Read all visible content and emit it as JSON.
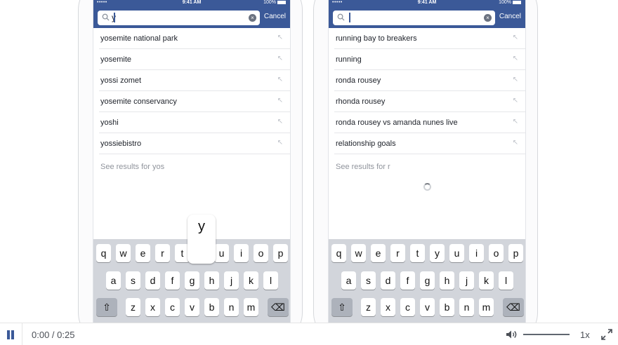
{
  "status": {
    "time": "9:41 AM",
    "battery": "100%",
    "signal": "•••••"
  },
  "left_phone": {
    "typed": "y",
    "cancel_label": "Cancel",
    "suggestions": [
      "yosemite national park",
      "yosemite",
      "yossi zomet",
      "yosemite conservancy",
      "yoshi",
      "yossiebistro"
    ],
    "see_results": "See results for yos",
    "popup_key": "y"
  },
  "right_phone": {
    "typed": "",
    "cancel_label": "Cancel",
    "suggestions": [
      "running bay to breakers",
      "running",
      "ronda rousey",
      "rhonda rousey",
      "ronda rousey vs amanda nunes live",
      "relationship goals"
    ],
    "see_results": "See results for r"
  },
  "keyboard": {
    "row1": [
      "q",
      "w",
      "e",
      "r",
      "t",
      "y",
      "u",
      "i",
      "o",
      "p"
    ],
    "row2": [
      "a",
      "s",
      "d",
      "f",
      "g",
      "h",
      "j",
      "k",
      "l"
    ],
    "row3": [
      "z",
      "x",
      "c",
      "v",
      "b",
      "n",
      "m"
    ]
  },
  "controls": {
    "time": "0:00 / 0:25",
    "speed": "1x"
  },
  "colors": {
    "facebook_blue": "#3b5998",
    "keyboard_bg": "#d2d5db"
  }
}
